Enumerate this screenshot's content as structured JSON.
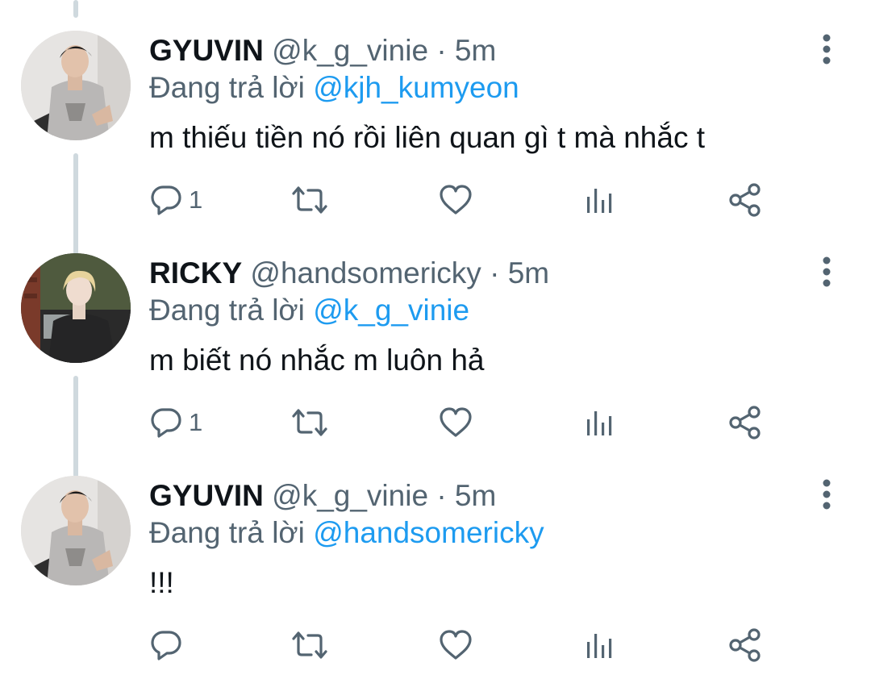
{
  "tweets": [
    {
      "display_name": "GYUVIN",
      "handle": "@k_g_vinie",
      "separator": "·",
      "time": "5m",
      "replying_prefix": "Đang trả lời",
      "replying_to": "@kjh_kumyeon",
      "text": "m thiếu tiền nó rồi liên quan gì t mà nhắc t",
      "reply_count": "1",
      "icons": [
        "reply-icon",
        "retweet-icon",
        "like-icon",
        "views-icon",
        "share-icon",
        "more-icon"
      ]
    },
    {
      "display_name": "RICKY",
      "handle": "@handsomericky",
      "separator": "·",
      "time": "5m",
      "replying_prefix": "Đang trả lời",
      "replying_to": "@k_g_vinie",
      "text": "m biết nó nhắc m luôn hả",
      "reply_count": "1",
      "icons": [
        "reply-icon",
        "retweet-icon",
        "like-icon",
        "views-icon",
        "share-icon",
        "more-icon"
      ]
    },
    {
      "display_name": "GYUVIN",
      "handle": "@k_g_vinie",
      "separator": "·",
      "time": "5m",
      "replying_prefix": "Đang trả lời",
      "replying_to": "@handsomericky",
      "text": "!!!",
      "reply_count": "",
      "icons": [
        "reply-icon",
        "retweet-icon",
        "like-icon",
        "views-icon",
        "share-icon",
        "more-icon"
      ]
    }
  ],
  "colors": {
    "text_primary": "#0f1419",
    "text_secondary": "#536471",
    "link": "#1d9bf0",
    "thread_line": "#cfd9de"
  }
}
